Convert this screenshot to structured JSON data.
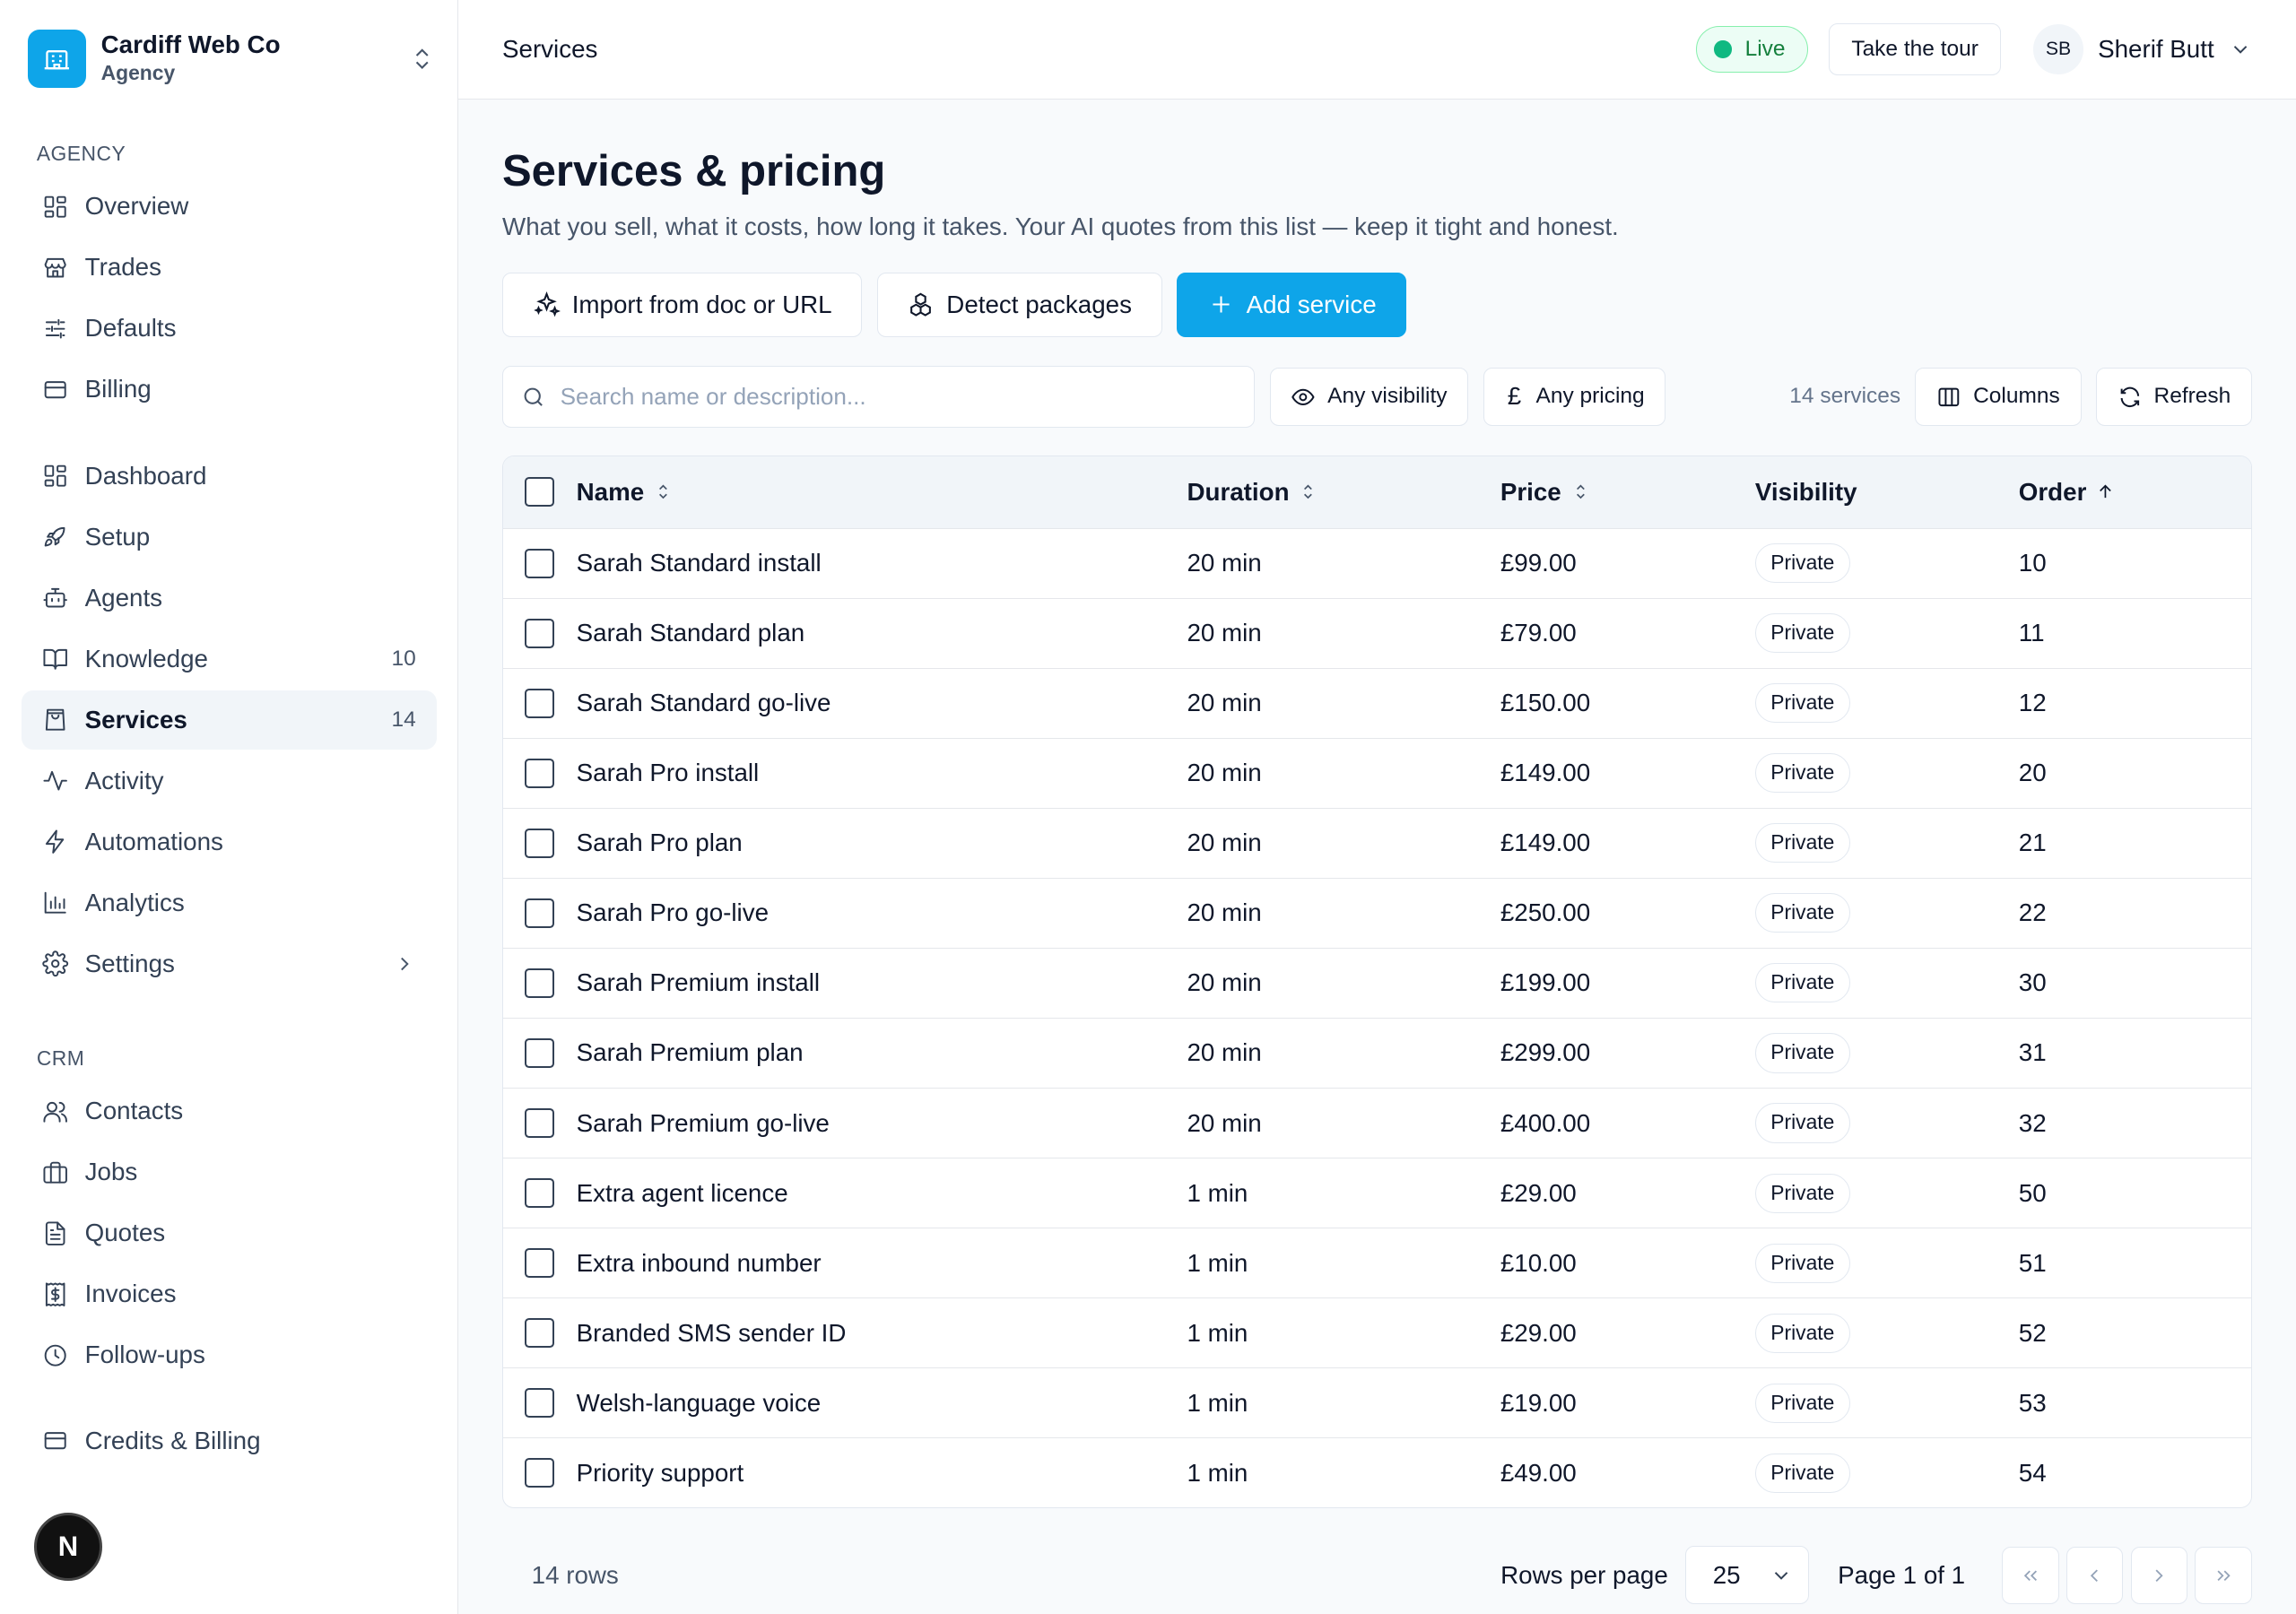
{
  "org": {
    "name": "Cardiff Web Co",
    "type": "Agency"
  },
  "sidebar": {
    "section_agency": "AGENCY",
    "agency_items": [
      {
        "label": "Overview",
        "icon": "layout-grid-icon"
      },
      {
        "label": "Trades",
        "icon": "store-icon"
      },
      {
        "label": "Defaults",
        "icon": "sliders-icon"
      },
      {
        "label": "Billing",
        "icon": "credit-card-icon"
      }
    ],
    "main_items": [
      {
        "label": "Dashboard",
        "icon": "layout-grid-icon"
      },
      {
        "label": "Setup",
        "icon": "rocket-icon"
      },
      {
        "label": "Agents",
        "icon": "bot-icon"
      },
      {
        "label": "Knowledge",
        "icon": "book-icon",
        "count": "10"
      },
      {
        "label": "Services",
        "icon": "shopping-bag-icon",
        "count": "14",
        "active": true
      },
      {
        "label": "Activity",
        "icon": "activity-icon"
      },
      {
        "label": "Automations",
        "icon": "zap-icon"
      },
      {
        "label": "Analytics",
        "icon": "bar-chart-icon"
      },
      {
        "label": "Settings",
        "icon": "gear-icon",
        "has_submenu": true
      }
    ],
    "section_crm": "CRM",
    "crm_items": [
      {
        "label": "Contacts",
        "icon": "users-icon"
      },
      {
        "label": "Jobs",
        "icon": "briefcase-icon"
      },
      {
        "label": "Quotes",
        "icon": "file-text-icon"
      },
      {
        "label": "Invoices",
        "icon": "receipt-icon"
      },
      {
        "label": "Follow-ups",
        "icon": "clock-icon"
      }
    ],
    "footer_item": {
      "label": "Credits & Billing",
      "icon": "credit-card-icon"
    },
    "badge_letter": "N"
  },
  "topbar": {
    "breadcrumb": "Services",
    "status": "Live",
    "tour_label": "Take the tour",
    "user_initials": "SB",
    "user_name": "Sherif Butt"
  },
  "page": {
    "title": "Services & pricing",
    "subtitle": "What you sell, what it costs, how long it takes. Your AI quotes from this list — keep it tight and honest.",
    "actions": {
      "import": "Import from doc or URL",
      "detect": "Detect packages",
      "add": "Add service"
    },
    "search_placeholder": "Search name or description...",
    "filter_visibility": "Any visibility",
    "filter_pricing": "Any pricing",
    "pricing_symbol": "£",
    "service_count": "14 services",
    "columns_label": "Columns",
    "refresh_label": "Refresh"
  },
  "table": {
    "headers": {
      "name": "Name",
      "duration": "Duration",
      "price": "Price",
      "visibility": "Visibility",
      "order": "Order"
    },
    "rows": [
      {
        "name": "Sarah Standard install",
        "duration": "20 min",
        "price": "£99.00",
        "visibility": "Private",
        "order": "10"
      },
      {
        "name": "Sarah Standard plan",
        "duration": "20 min",
        "price": "£79.00",
        "visibility": "Private",
        "order": "11"
      },
      {
        "name": "Sarah Standard go-live",
        "duration": "20 min",
        "price": "£150.00",
        "visibility": "Private",
        "order": "12"
      },
      {
        "name": "Sarah Pro install",
        "duration": "20 min",
        "price": "£149.00",
        "visibility": "Private",
        "order": "20"
      },
      {
        "name": "Sarah Pro plan",
        "duration": "20 min",
        "price": "£149.00",
        "visibility": "Private",
        "order": "21"
      },
      {
        "name": "Sarah Pro go-live",
        "duration": "20 min",
        "price": "£250.00",
        "visibility": "Private",
        "order": "22"
      },
      {
        "name": "Sarah Premium install",
        "duration": "20 min",
        "price": "£199.00",
        "visibility": "Private",
        "order": "30"
      },
      {
        "name": "Sarah Premium plan",
        "duration": "20 min",
        "price": "£299.00",
        "visibility": "Private",
        "order": "31"
      },
      {
        "name": "Sarah Premium go-live",
        "duration": "20 min",
        "price": "£400.00",
        "visibility": "Private",
        "order": "32"
      },
      {
        "name": "Extra agent licence",
        "duration": "1 min",
        "price": "£29.00",
        "visibility": "Private",
        "order": "50"
      },
      {
        "name": "Extra inbound number",
        "duration": "1 min",
        "price": "£10.00",
        "visibility": "Private",
        "order": "51"
      },
      {
        "name": "Branded SMS sender ID",
        "duration": "1 min",
        "price": "£29.00",
        "visibility": "Private",
        "order": "52"
      },
      {
        "name": "Welsh-language voice",
        "duration": "1 min",
        "price": "£19.00",
        "visibility": "Private",
        "order": "53"
      },
      {
        "name": "Priority support",
        "duration": "1 min",
        "price": "£49.00",
        "visibility": "Private",
        "order": "54"
      }
    ]
  },
  "footer": {
    "rows_count": "14 rows",
    "rows_per_page_label": "Rows per page",
    "rows_per_page": "25",
    "page_label": "Page 1 of 1"
  },
  "colors": {
    "accent": "#0ea5e9",
    "live": "#10b981"
  }
}
